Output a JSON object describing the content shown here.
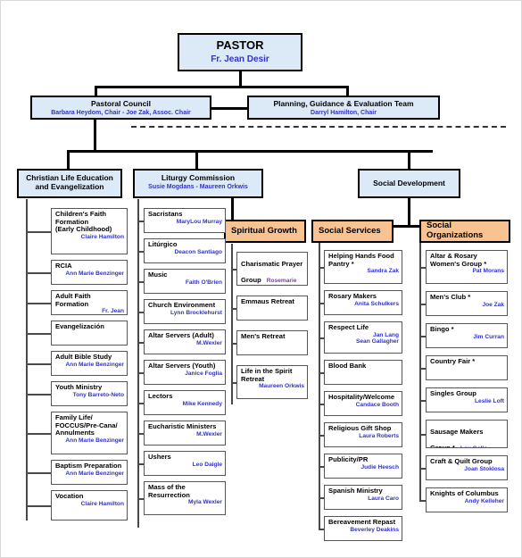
{
  "pastor": {
    "title": "PASTOR",
    "name": "Fr. Jean Desir"
  },
  "row2": [
    {
      "title": "Pastoral Council",
      "name": "Barbara Heydom, Chair  -  Joe Zak, Assoc. Chair"
    },
    {
      "title": "Planning, Guidance & Evaluation Team",
      "name": "Darryl Hamilton, Chair"
    }
  ],
  "divisions": [
    {
      "title": "Christian Life Education\nand Evangelization",
      "name": ""
    },
    {
      "title": "Liturgy Commission",
      "name": "Susie Mogdans - Maureen Orkwis"
    },
    {
      "title": "Social Development",
      "name": ""
    }
  ],
  "subheads": [
    {
      "title": "Spiritual Growth"
    },
    {
      "title": "Social Services"
    },
    {
      "title": "Social Organizations"
    }
  ],
  "columns": {
    "christian_life": [
      {
        "title": "Children's Faith\nFormation\n(Early Childhood)",
        "name": "Claire Hamilton"
      },
      {
        "title": "RCIA",
        "name": "Ann Marie Benzinger"
      },
      {
        "title": "Adult Faith Formation",
        "name": "Fr. Jean"
      },
      {
        "title": "Evangelización",
        "name": ""
      },
      {
        "title": "Adult Bible Study",
        "name": "Ann Marie Benzinger"
      },
      {
        "title": "Youth Ministry",
        "name": "Tony Barreto-Neto"
      },
      {
        "title": "Family Life/\nFOCCUS/Pre-Cana/\nAnnulments",
        "name": "Ann Marie Benzinger"
      },
      {
        "title": "Baptism Preparation",
        "name": "Ann Marie Benzinger"
      },
      {
        "title": "Vocation",
        "name": "Claire Hamilton"
      }
    ],
    "liturgy": [
      {
        "title": "Sacristans",
        "name": "MaryLou Murray"
      },
      {
        "title": "Litúrgico",
        "name": "Deacon Santiago"
      },
      {
        "title": "Music",
        "name": "Faith O'Brien"
      },
      {
        "title": "Church Environment",
        "name": "Lynn Brocklehurst"
      },
      {
        "title": "Altar Servers (Adult)",
        "name": "M.Wexler"
      },
      {
        "title": "Altar Servers (Youth)",
        "name": "Janice Foglia"
      },
      {
        "title": "Lectors",
        "name": "Mike Kennedy"
      },
      {
        "title": "Eucharistic Ministers",
        "name": "M.Wexler"
      },
      {
        "title": "Ushers",
        "name": "Leo Daigle"
      },
      {
        "title": "Mass of the\nResurrection",
        "name": "Myla Wexler"
      }
    ],
    "spiritual_growth": [
      {
        "title": "Charismatic Prayer\nGroup",
        "name": "Rosemarie\nHellegaard",
        "name_color": "purple",
        "inline": true
      },
      {
        "title": "Emmaus Retreat",
        "name": ""
      },
      {
        "title": "Men's Retreat",
        "name": ""
      },
      {
        "title": "Life in the Spirit\nRetreat",
        "name": "Maureen Orkwis"
      }
    ],
    "social_services": [
      {
        "title": "Helping Hands Food\nPantry *",
        "name": "Sandra Zak"
      },
      {
        "title": "Rosary Makers",
        "name": "Anita Schulkers"
      },
      {
        "title": "Respect Life",
        "name": "Jan Lang\nSean Gallagher"
      },
      {
        "title": "Blood Bank",
        "name": ""
      },
      {
        "title": "Hospitality/Welcome",
        "name": "Candace Booth"
      },
      {
        "title": "Religious Gift Shop",
        "name": "Laura Roberts"
      },
      {
        "title": "Publicity/PR",
        "name": "Judie Heesch"
      },
      {
        "title": "Spanish Ministry",
        "name": "Laura Caro"
      },
      {
        "title": "Bereavement Repast",
        "name": "Beverley Deakins"
      }
    ],
    "social_organizations": [
      {
        "title": "Altar & Rosary\nWomen's Group *",
        "name": "Pat Morans"
      },
      {
        "title": "Men's Club *",
        "name": "Joe Zak"
      },
      {
        "title": "Bingo *",
        "name": "Jim Curran"
      },
      {
        "title": "Country Fair *",
        "name": ""
      },
      {
        "title": "Singles Group",
        "name": "Leslie Loft"
      },
      {
        "title": "Sausage Makers\nGroup *",
        "name": "Lou Gallo",
        "inline": true
      },
      {
        "title": "Craft & Quilt Group",
        "name": "Joan Stoklosa"
      },
      {
        "title": "Knights of Columbus",
        "name": "Andy Kelleher"
      }
    ]
  },
  "colors": {
    "blue_fill": "#dce9f7",
    "orange_fill": "#f8c291",
    "name_blue": "#3232c8",
    "name_purple": "#7a3fa8",
    "line_black": "#000000",
    "line_gray": "#4a4a4a"
  }
}
